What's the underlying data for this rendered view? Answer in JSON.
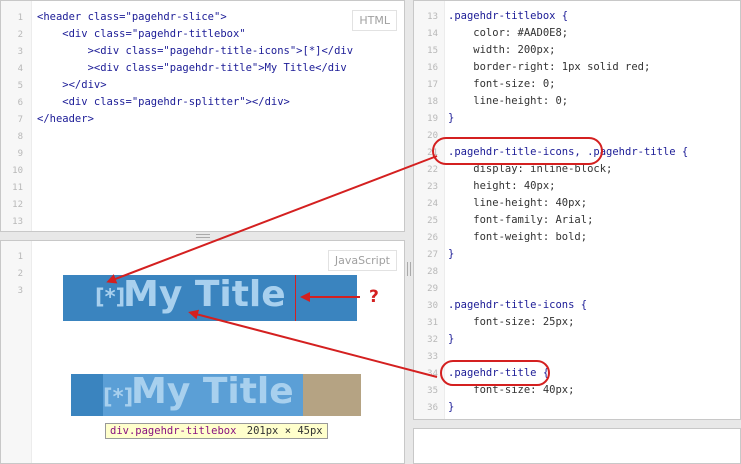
{
  "html_panel": {
    "label": "HTML",
    "line_numbers": [
      "1",
      "2",
      "3",
      "4",
      "5",
      "6",
      "7",
      "8",
      "9",
      "10",
      "11",
      "12",
      "13"
    ],
    "lines": [
      "<header class=\"pagehdr-slice\">",
      "    <div class=\"pagehdr-titlebox\"",
      "        ><div class=\"pagehdr-title-icons\">[*]</div",
      "        ><div class=\"pagehdr-title\">My Title</div",
      "    ></div>",
      "    <div class=\"pagehdr-splitter\"></div>",
      "</header>"
    ]
  },
  "css_panel": {
    "line_numbers": [
      "13",
      "14",
      "15",
      "16",
      "17",
      "18",
      "19",
      "20",
      "21",
      "22",
      "23",
      "24",
      "25",
      "26",
      "27",
      "28",
      "29",
      "30",
      "31",
      "32",
      "33",
      "34",
      "35",
      "36"
    ],
    "lines": [
      ".pagehdr-titlebox {",
      "    color: #AAD0E8;",
      "    width: 200px;",
      "    border-right: 1px solid red;",
      "    font-size: 0;",
      "    line-height: 0;",
      "}",
      "",
      ".pagehdr-title-icons, .pagehdr-title {",
      "    display: inline-block;",
      "    height: 40px;",
      "    line-height: 40px;",
      "    font-family: Arial;",
      "    font-weight: bold;",
      "}",
      "",
      "",
      ".pagehdr-title-icons {",
      "    font-size: 25px;",
      "}",
      "",
      ".pagehdr-title {",
      "    font-size: 40px;",
      "}",
      ""
    ]
  },
  "js_panel": {
    "label": "JavaScript",
    "line_numbers": [
      "1",
      "2",
      "3"
    ]
  },
  "preview": {
    "icons_text": "[*]",
    "title_text": "My Title",
    "question_mark": "?",
    "tooltip_selector": "div.pagehdr-titlebox",
    "tooltip_size": "201px × 45px"
  },
  "colors": {
    "title_bar": "#3a84bf",
    "title_text": "#a8d0ee",
    "annotation_red": "#d42020",
    "margin_tan": "#b5a383",
    "highlight_blue": "#5b9fd6"
  }
}
